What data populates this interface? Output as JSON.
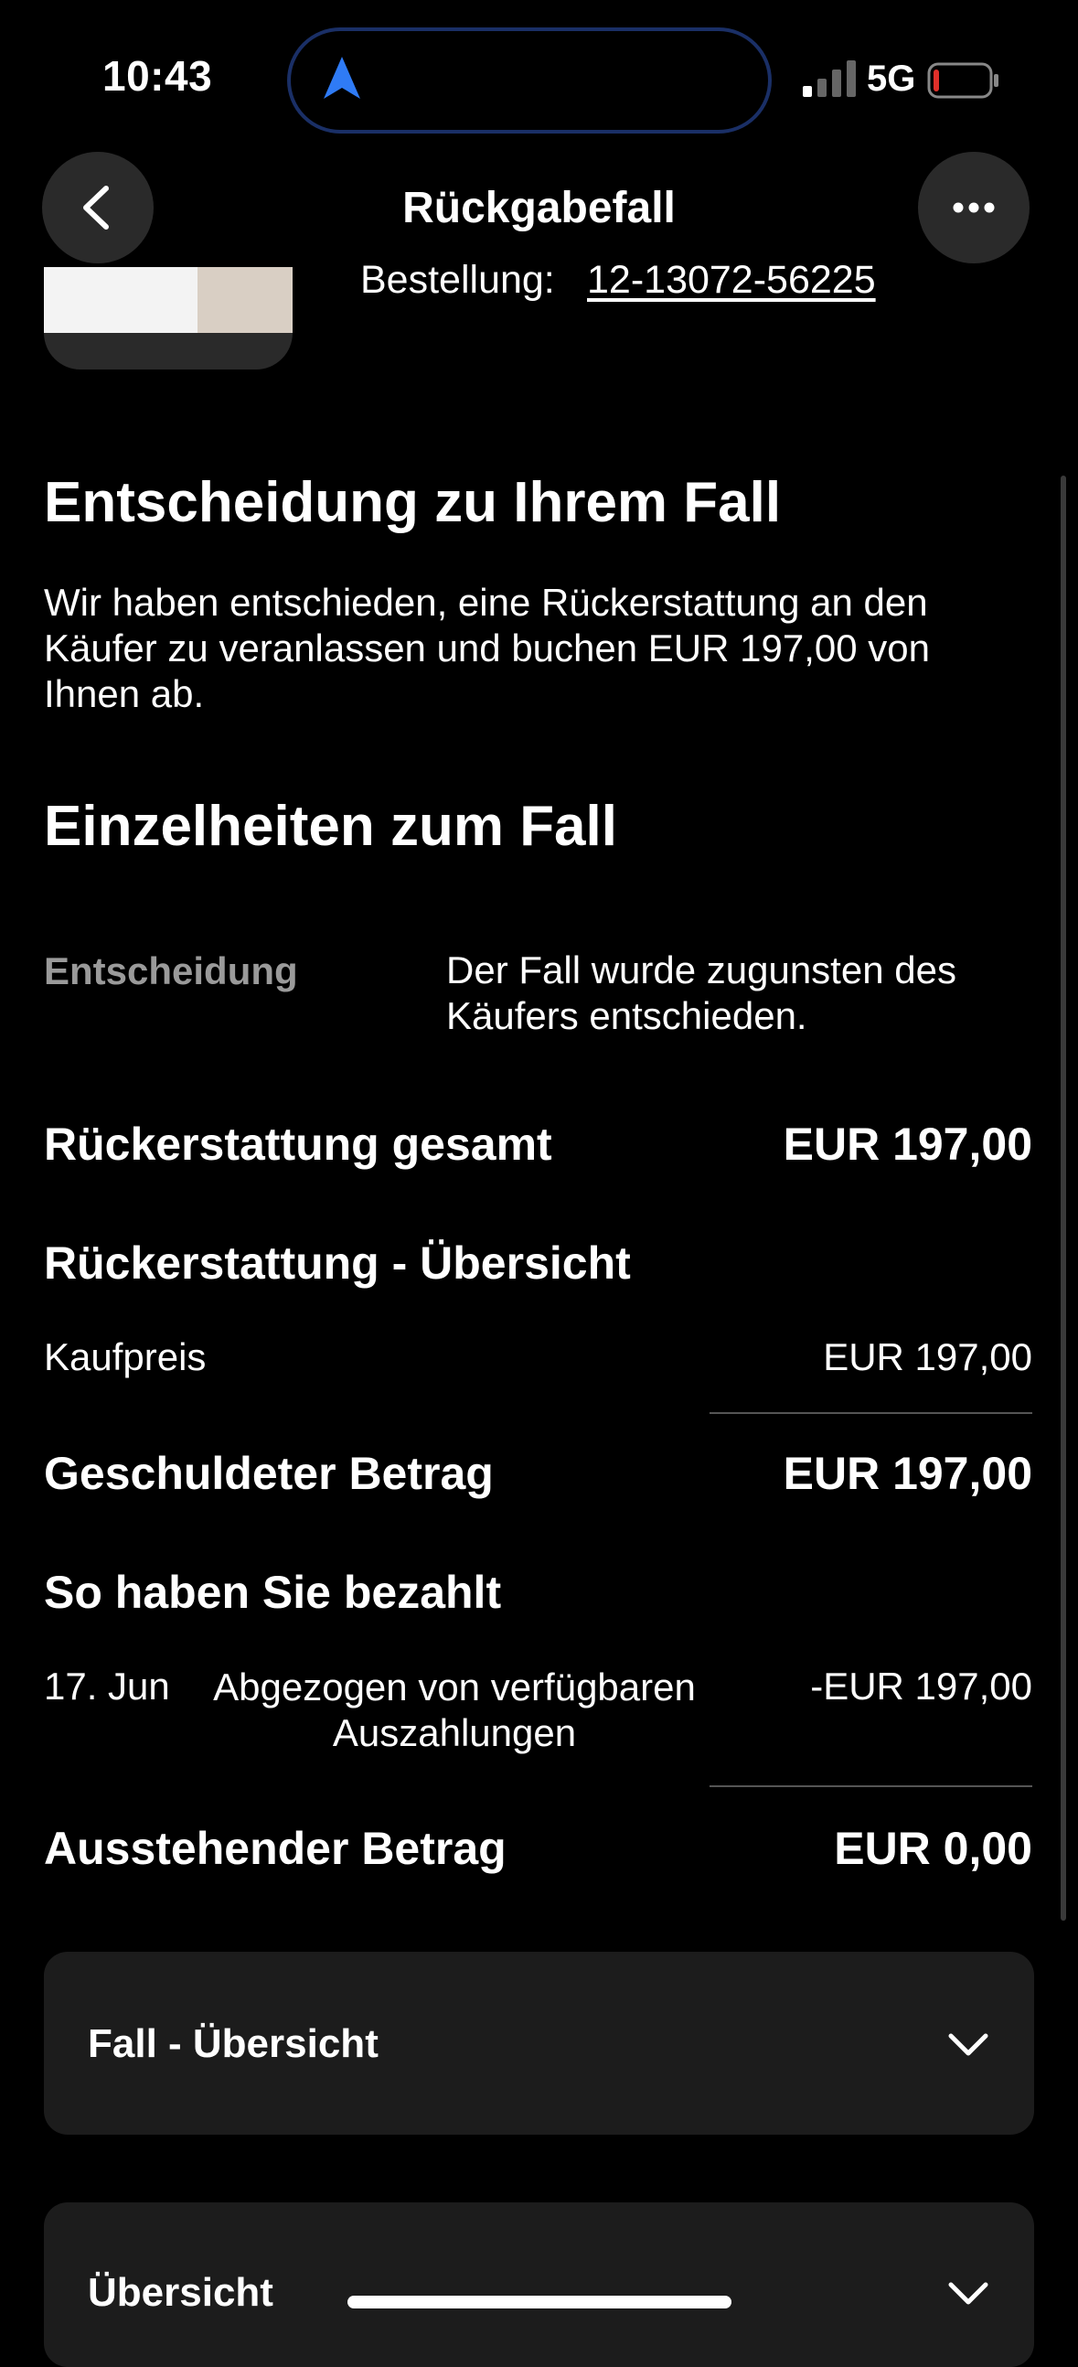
{
  "status_bar": {
    "time": "10:43",
    "network": "5G"
  },
  "header": {
    "title": "Rückgabefall"
  },
  "order": {
    "label": "Bestellung:",
    "number": "12-13072-56225"
  },
  "decision": {
    "heading": "Entscheidung zu Ihrem Fall",
    "text": "Wir haben entschieden, eine Rückerstattung an den Käufer zu veranlassen und buchen EUR 197,00 von Ihnen ab."
  },
  "details": {
    "heading": "Einzelheiten zum Fall",
    "decision_label": "Entscheidung",
    "decision_value": "Der Fall wurde zugunsten des Käufers entschieden.",
    "refund_total_label": "Rückerstattung gesamt",
    "refund_total_value": "EUR 197,00",
    "overview_heading": "Rückerstattung - Übersicht",
    "purchase_price_label": "Kaufpreis",
    "purchase_price_value": "EUR 197,00",
    "owed_label": "Geschuldeter Betrag",
    "owed_value": "EUR 197,00",
    "paid_heading": "So haben Sie bezahlt",
    "payment_date": "17. Jun",
    "payment_desc": "Abgezogen von verfügbaren Auszahlungen",
    "payment_amount": "-EUR 197,00",
    "outstanding_label": "Ausstehender Betrag",
    "outstanding_value": "EUR 0,00"
  },
  "accordions": [
    {
      "label": "Fall - Übersicht"
    },
    {
      "label": "Übersicht"
    }
  ],
  "icons": {
    "back": "chevron-left-icon",
    "more": "more-horizontal-icon",
    "expand": "chevron-down-icon",
    "location": "navigation-arrow-icon"
  },
  "colors": {
    "background": "#000000",
    "card": "#1c1c1c",
    "muted_text": "#9a9a9a",
    "nav_arrow": "#2f7bf5"
  }
}
